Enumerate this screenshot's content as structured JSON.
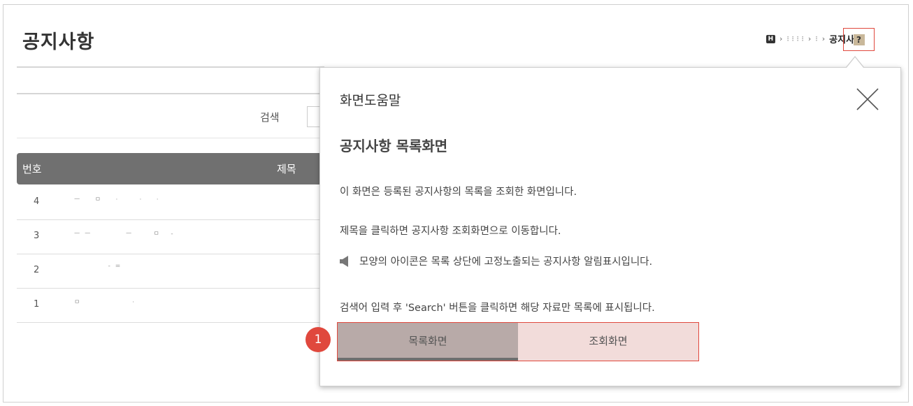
{
  "page": {
    "title": "공지사항"
  },
  "breadcrumb": {
    "home_glyph": "H",
    "crumb1": "⁝ ⁝ ⁝  ⁝",
    "crumb2": "⁝",
    "separator": "›",
    "current": "공지사항"
  },
  "help_button": {
    "glyph": "?"
  },
  "search": {
    "label": "검색"
  },
  "table": {
    "headers": {
      "num": "번호",
      "title": "제목"
    },
    "rows": [
      {
        "num": "4",
        "title": "ㅡ    ㅁ    ·      ·    ·"
      },
      {
        "num": "3",
        "title": "ㅡ ㅡ          ㅡ      ㅁ   -"
      },
      {
        "num": "2",
        "title": "          - ="
      },
      {
        "num": "1",
        "title": "ㅁ               ·"
      }
    ]
  },
  "help_popup": {
    "title": "화면도움말",
    "subtitle": "공지사항 목록화면",
    "line1": "이 화면은 등록된 공지사항의 목록을 조회한 화면입니다.",
    "line2": "제목을 클릭하면 공지사항 조회화면으로 이동합니다.",
    "line3": "모양의 아이콘은 목록 상단에 고정노출되는 공지사항 알림표시입니다.",
    "line4": "검색어 입력 후 'Search' 버튼을 클릭하면 해당 자료만 목록에 표시됩니다.",
    "tabs": [
      "목록화면",
      "조회화면"
    ],
    "step_badge": "1"
  },
  "colors": {
    "accent_red": "#e0483d",
    "table_header": "#707070",
    "tab_active": "#b8aaa8",
    "tab_inactive": "#f2dcda"
  },
  "icons": {
    "home": "home-icon",
    "help": "help-icon",
    "close": "close-icon",
    "speaker": "speaker-icon"
  }
}
